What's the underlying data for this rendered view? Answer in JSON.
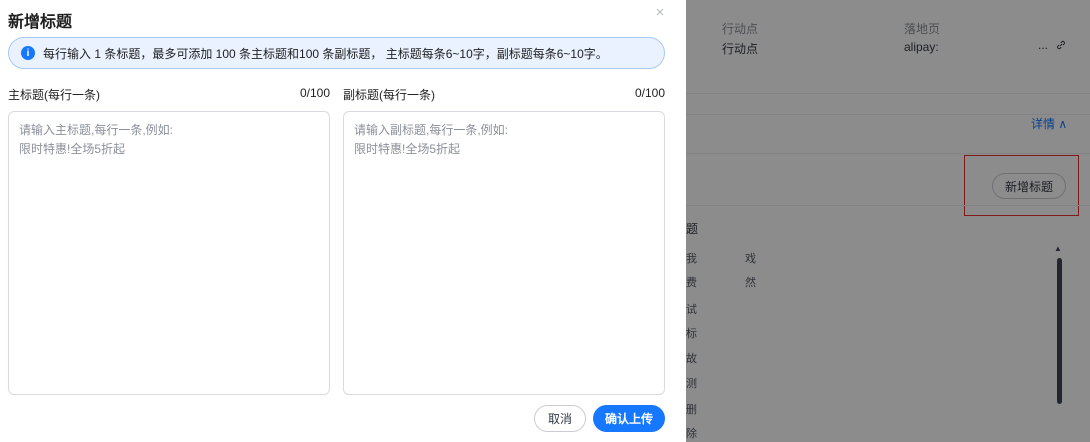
{
  "modal": {
    "title": "新增标题",
    "close_icon": "×",
    "info_icon": "i",
    "info_text": "每行输入 1 条标题，最多可添加 100 条主标题和100 条副标题， 主标题每条6~10字，副标题每条6~10字。",
    "main_title": {
      "label": "主标题(每行一条)",
      "count": "0/100",
      "placeholder": "请输入主标题,每行一条,例如:\n限时特惠!全场5折起",
      "value": ""
    },
    "sub_title": {
      "label": "副标题(每行一条)",
      "count": "0/100",
      "placeholder": "请输入副标题,每行一条,例如:\n限时特惠!全场5折起",
      "value": ""
    },
    "cancel_label": "取消",
    "confirm_label": "确认上传"
  },
  "background": {
    "header": {
      "col_action_label": "行动点",
      "col_landing_label": "落地页",
      "action_value": "行动点",
      "landing_value": "alipay:",
      "more_label": "...",
      "link_icon": "🔗"
    },
    "detail_link": "详情 ∧",
    "add_title_button": "新增标题",
    "section_label": "题",
    "table_cells": [
      "我",
      "戏",
      "费",
      "然",
      "试",
      "标",
      "故",
      "测",
      "删",
      "除"
    ]
  },
  "colors": {
    "accent": "#1677ff",
    "highlight_border": "#e5312f"
  }
}
